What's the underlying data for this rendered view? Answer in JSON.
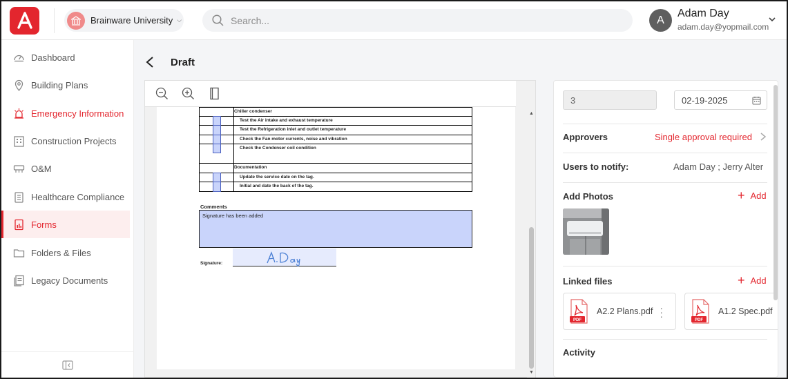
{
  "org": {
    "name": "Brainware University"
  },
  "search": {
    "placeholder": "Search..."
  },
  "user": {
    "initial": "A",
    "name": "Adam Day",
    "email": "adam.day@yopmail.com"
  },
  "sidebar": {
    "items": [
      {
        "label": "Dashboard",
        "icon": "gauge-icon"
      },
      {
        "label": "Building Plans",
        "icon": "map-pin-icon"
      },
      {
        "label": "Emergency Information",
        "icon": "siren-icon"
      },
      {
        "label": "Construction Projects",
        "icon": "building-icon"
      },
      {
        "label": "O&M",
        "icon": "tools-icon"
      },
      {
        "label": "Healthcare Compliance",
        "icon": "clipboard-icon"
      },
      {
        "label": "Forms",
        "icon": "form-icon"
      },
      {
        "label": "Folders & Files",
        "icon": "folder-icon"
      },
      {
        "label": "Legacy Documents",
        "icon": "document-icon"
      }
    ]
  },
  "page": {
    "title": "Draft"
  },
  "document": {
    "rows": [
      {
        "text": "Chiller condenser",
        "header": true
      },
      {
        "text": "Test the Air intake and exhaust temperature"
      },
      {
        "text": "Test the Refrigeration inlet and outlet temperature"
      },
      {
        "text": "Check the Fan motor currents, noise and vibration"
      },
      {
        "text": "Check the Condenser coil condition"
      },
      {
        "text": "Documentation",
        "header": true
      },
      {
        "text": "Update the service date on the tag."
      },
      {
        "text": "Initial and date the back of the tag."
      }
    ],
    "comments_label": "Comments",
    "comments_text": "Signature has been added",
    "signature_label": "Signature:",
    "signature_value": "A.Day"
  },
  "panel": {
    "number_value": "3",
    "date_value": "02-19-2025",
    "approvers_label": "Approvers",
    "approvers_value": "Single approval required",
    "notify_label": "Users to notify:",
    "notify_value": "Adam Day ;   Jerry Alter",
    "photos_label": "Add Photos",
    "add_label": "Add",
    "linked_label": "Linked files",
    "files": [
      {
        "name": "A2.2 Plans.pdf",
        "type": "PDF"
      },
      {
        "name": "A1.2 Spec.pdf",
        "type": "PDF"
      }
    ],
    "activity_label": "Activity"
  },
  "colors": {
    "brand": "#e3262e",
    "form_highlight": "#c9d4fb"
  }
}
